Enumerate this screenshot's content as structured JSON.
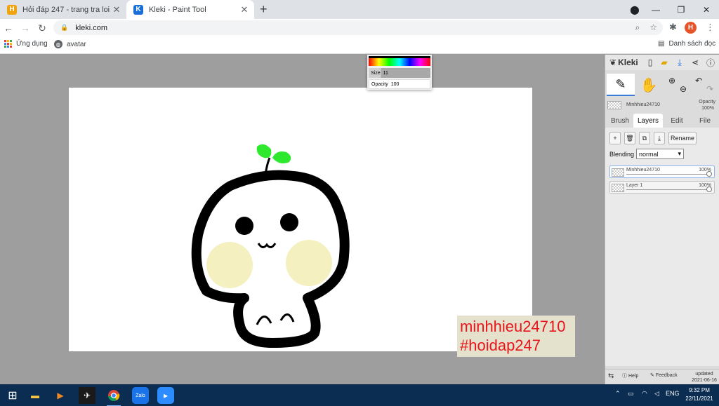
{
  "browser": {
    "tabs": [
      {
        "title": "Hỏi đáp 247 - trang tra loi",
        "favicon": "H",
        "favicon_color": "#f0a30a",
        "active": false
      },
      {
        "title": "Kleki - Paint Tool",
        "favicon": "K",
        "favicon_color": "#1a6fd6",
        "active": true
      }
    ],
    "close_glyph": "✕",
    "new_tab_glyph": "+",
    "url": "kleki.com",
    "profile_initial": "H",
    "bookmarks": [
      {
        "label": "Ứng dụng"
      },
      {
        "label": "avatar"
      }
    ],
    "reading_list_label": "Danh sách đọc"
  },
  "brush_popup": {
    "size_label": "Size",
    "size_value": "11",
    "opacity_label": "Opacity",
    "opacity_value": "100"
  },
  "watermark": {
    "line1": "minhhieu24710",
    "line2": "#hoidap247"
  },
  "kleki": {
    "logo_text": "Kleki",
    "current_layer_name": "Minhhieu24710",
    "opacity_label": "Opacity",
    "opacity_value": "100%",
    "tabs": [
      {
        "label": "Brush",
        "active": false
      },
      {
        "label": "Layers",
        "active": true
      },
      {
        "label": "Edit",
        "active": false
      },
      {
        "label": "File",
        "active": false
      }
    ],
    "layer_buttons": {
      "add": "+",
      "delete": "🗑",
      "duplicate": "⧉",
      "merge": "⤓",
      "rename": "Rename"
    },
    "blending_label": "Blending",
    "blending_value": "normal",
    "layers": [
      {
        "name": "Minhhieu24710",
        "opacity": "100%",
        "selected": true
      },
      {
        "name": "Layer 1",
        "opacity": "100%",
        "selected": false
      }
    ],
    "footer": {
      "help": "Help",
      "feedback": "Feedback",
      "updated_label": "updated",
      "updated_date": "2021-06-16"
    }
  },
  "taskbar": {
    "language": "ENG",
    "time": "9:32 PM",
    "date": "22/11/2021"
  },
  "colors": {
    "accent": "#1a73e8",
    "watermark_text": "#e8161b",
    "watermark_bg": "#e4e1cc",
    "taskbar": "#0b2d52",
    "leaf_green": "#2ee82e",
    "cheek": "#f4f0c0"
  }
}
